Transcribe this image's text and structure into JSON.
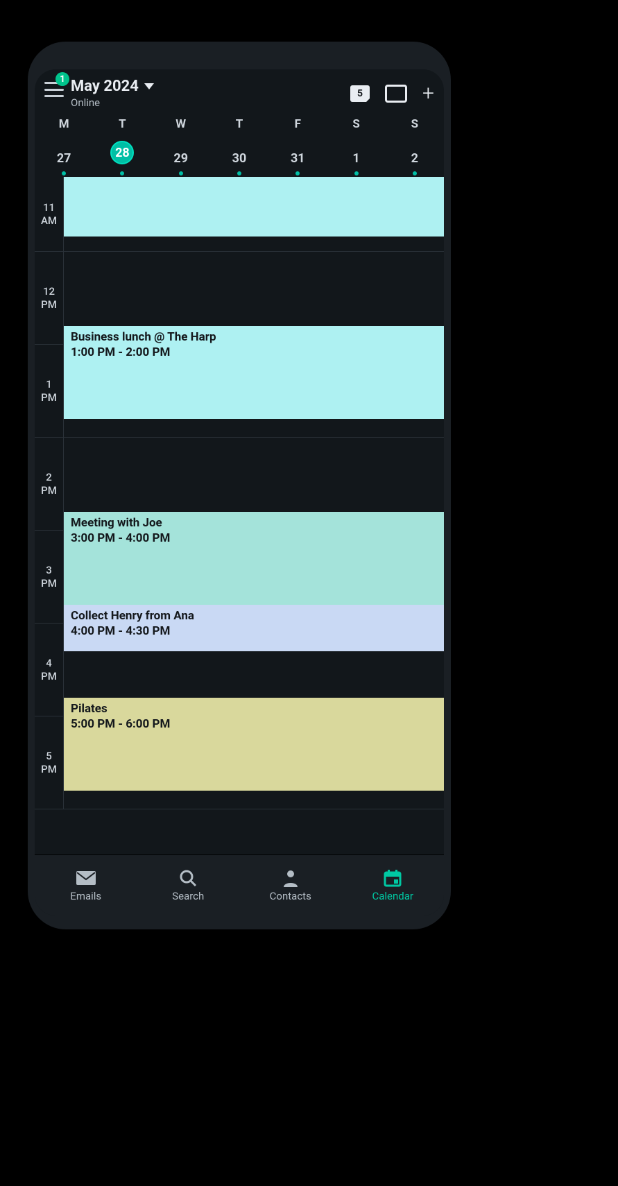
{
  "header": {
    "menu_badge": "1",
    "title": "May 2024",
    "subtitle": "Online",
    "today_day": "5"
  },
  "week": {
    "labels": [
      "M",
      "T",
      "W",
      "T",
      "F",
      "S",
      "S"
    ],
    "dates": [
      "27",
      "28",
      "29",
      "30",
      "31",
      "1",
      "2"
    ],
    "selected_index": 1,
    "dots": [
      true,
      true,
      true,
      true,
      true,
      true,
      true
    ]
  },
  "hours": [
    "11 AM",
    "12 PM",
    "1 PM",
    "2 PM",
    "3 PM",
    "4 PM",
    "5 PM"
  ],
  "events": [
    {
      "title": "",
      "time": "",
      "color": "cyan",
      "start_hour": 0,
      "end_hour": 0.8,
      "show_text": false
    },
    {
      "title": "Business lunch @ The Harp",
      "time": "1:00 PM - 2:00 PM",
      "color": "cyan",
      "start_hour": 1.8,
      "end_hour": 2.8,
      "show_text": true
    },
    {
      "title": "Meeting with Joe",
      "time": "3:00 PM - 4:00 PM",
      "color": "teal",
      "start_hour": 3.8,
      "end_hour": 4.8,
      "show_text": true
    },
    {
      "title": "Collect Henry from Ana",
      "time": "4:00 PM - 4:30 PM",
      "color": "blue",
      "start_hour": 4.8,
      "end_hour": 5.3,
      "show_text": true
    },
    {
      "title": "Pilates",
      "time": "5:00 PM - 6:00 PM",
      "color": "olive",
      "start_hour": 5.8,
      "end_hour": 6.8,
      "show_text": true
    }
  ],
  "nav": {
    "items": [
      {
        "label": "Emails",
        "icon": "mail"
      },
      {
        "label": "Search",
        "icon": "search"
      },
      {
        "label": "Contacts",
        "icon": "person"
      },
      {
        "label": "Calendar",
        "icon": "calendar"
      }
    ],
    "active_index": 3
  }
}
